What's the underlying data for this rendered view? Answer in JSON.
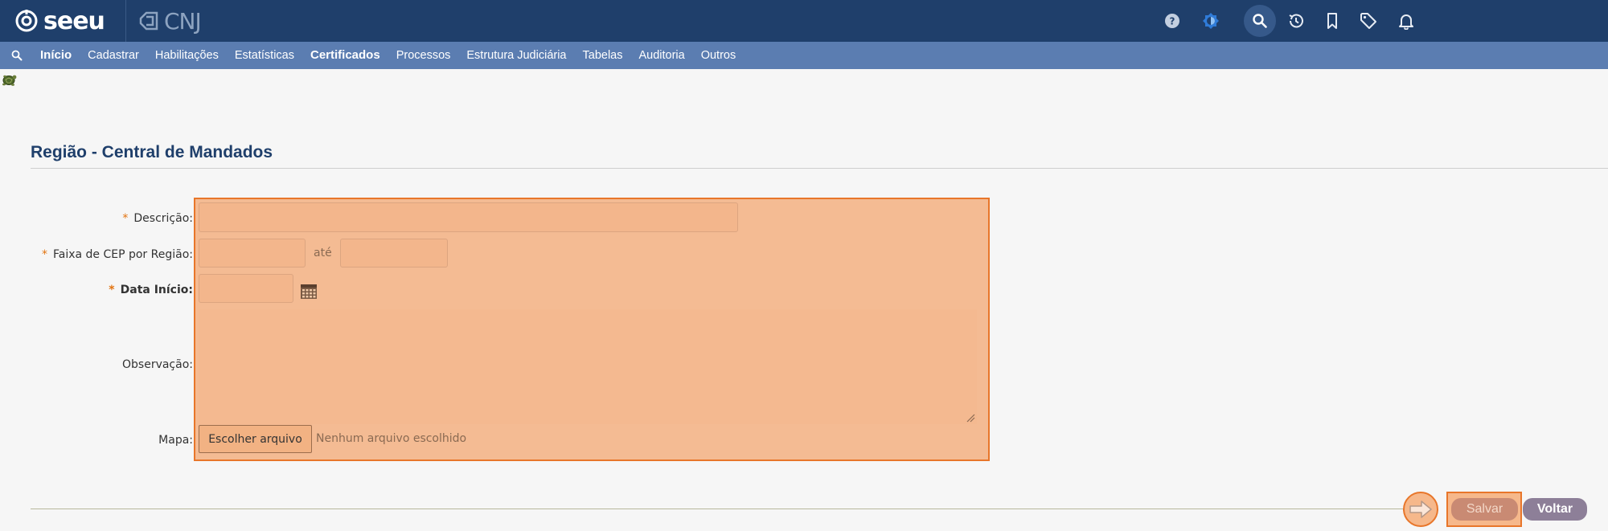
{
  "header": {
    "logo_text": "seeu",
    "cnj_text": "CNJ",
    "icons": [
      "help-icon",
      "theme-icon",
      "search-icon",
      "history-icon",
      "bookmark-icon",
      "tag-icon",
      "bell-icon"
    ]
  },
  "menu": {
    "items": [
      "Início",
      "Cadastrar",
      "Habilitações",
      "Estatísticas",
      "Certificados",
      "Processos",
      "Estrutura Judiciária",
      "Tabelas",
      "Auditoria",
      "Outros"
    ]
  },
  "page": {
    "title": "Região - Central de Mandados"
  },
  "form": {
    "required_mark": "*",
    "descricao_label": "Descrição:",
    "descricao_value": "",
    "cep_label": "Faixa de CEP por Região:",
    "cep_from_value": "",
    "cep_separator": "até",
    "cep_to_value": "",
    "data_inicio_label": "Data Início:",
    "data_inicio_value": "",
    "observacao_label": "Observação:",
    "observacao_value": "",
    "mapa_label": "Mapa:",
    "file_button": "Escolher arquivo",
    "file_status": "Nenhum arquivo escolhido"
  },
  "actions": {
    "salvar": "Salvar",
    "voltar": "Voltar"
  },
  "colors": {
    "topbar": "#1f3f6b",
    "menubar": "#5b7db1",
    "highlight": "#f4bb93",
    "highlight_border": "#e8762a",
    "required": "#e2730f"
  }
}
